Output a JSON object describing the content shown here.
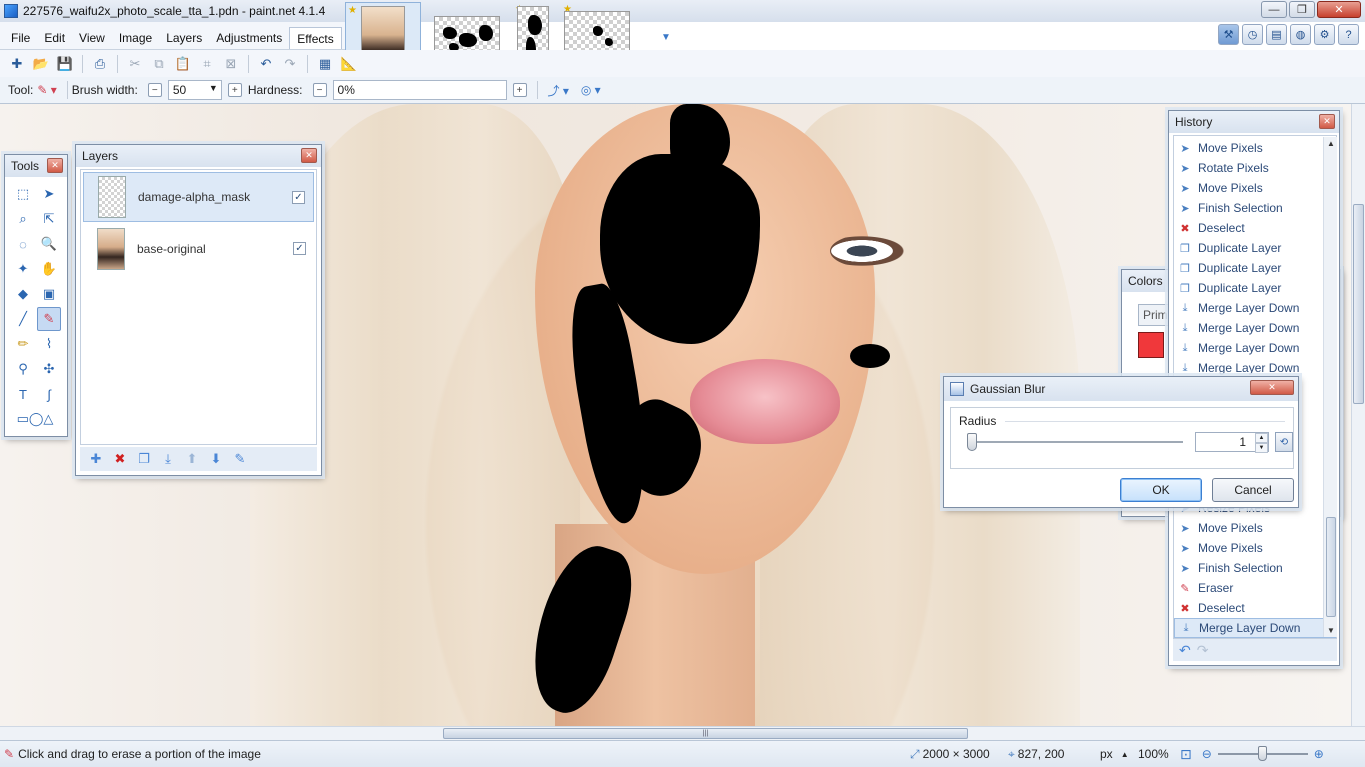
{
  "window": {
    "title": "227576_waifu2x_photo_scale_tta_1.pdn - paint.net 4.1.4",
    "min_glyph": "—",
    "max_glyph": "❐",
    "close_glyph": "✕"
  },
  "menu": [
    "File",
    "Edit",
    "View",
    "Image",
    "Layers",
    "Adjustments",
    "Effects"
  ],
  "toolbar": {
    "tool_label": "Tool:",
    "brush_width_label": "Brush width:",
    "brush_width_value": "50",
    "hardness_label": "Hardness:",
    "hardness_value": "0%"
  },
  "tools_panel": {
    "title": "Tools",
    "close": "✕"
  },
  "layers_panel": {
    "title": "Layers",
    "close": "✕",
    "layers": [
      {
        "name": "damage-alpha_mask",
        "visible": "✓"
      },
      {
        "name": "base-original",
        "visible": "✓"
      }
    ]
  },
  "colors_panel": {
    "title": "Colors",
    "primary": "Prim",
    "more": ">>",
    "primary_color": "#f0383b"
  },
  "history_panel": {
    "title": "History",
    "close": "✕",
    "items_top": [
      "Move Pixels",
      "Rotate Pixels",
      "Move Pixels",
      "Finish Selection",
      "Deselect",
      "Duplicate Layer",
      "Duplicate Layer",
      "Duplicate Layer",
      "Merge Layer Down",
      "Merge Layer Down",
      "Merge Layer Down",
      "Merge Layer Down"
    ],
    "items_bottom": [
      "Resize Pixels",
      "Move Pixels",
      "Move Pixels",
      "Finish Selection",
      "Eraser",
      "Deselect",
      "Merge Layer Down"
    ]
  },
  "gaussian_blur": {
    "title": "Gaussian Blur",
    "close": "✕",
    "radius_label": "Radius",
    "radius_value": "1",
    "ok": "OK",
    "cancel": "Cancel"
  },
  "status": {
    "hint": "Click and drag to erase a portion of the image",
    "image_size": "2000 × 3000",
    "cursor_pos": "827, 200",
    "unit": "px",
    "zoom": "100%"
  }
}
